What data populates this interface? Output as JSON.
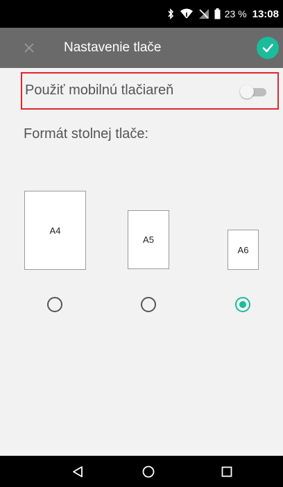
{
  "status_bar": {
    "battery_percent": "23 %",
    "time": "13:08",
    "icons": [
      "bluetooth-icon",
      "wifi-icon",
      "no-sim-icon",
      "battery-icon"
    ]
  },
  "toolbar": {
    "title": "Nastavenie tlače",
    "close_icon": "close-icon",
    "confirm_icon": "check-icon"
  },
  "mobile_printer": {
    "label": "Použiť mobilnú tlačiareň",
    "enabled": false
  },
  "desktop_format": {
    "title": "Formát stolnej tlače:",
    "options": [
      {
        "label": "A4",
        "selected": false
      },
      {
        "label": "A5",
        "selected": false
      },
      {
        "label": "A6",
        "selected": true
      }
    ]
  },
  "nav_bar": {
    "buttons": [
      "back-icon",
      "home-icon",
      "recents-icon"
    ]
  },
  "colors": {
    "accent": "#1abc9c",
    "toolbar": "#6a6a6a",
    "highlight_border": "#e5222d"
  }
}
